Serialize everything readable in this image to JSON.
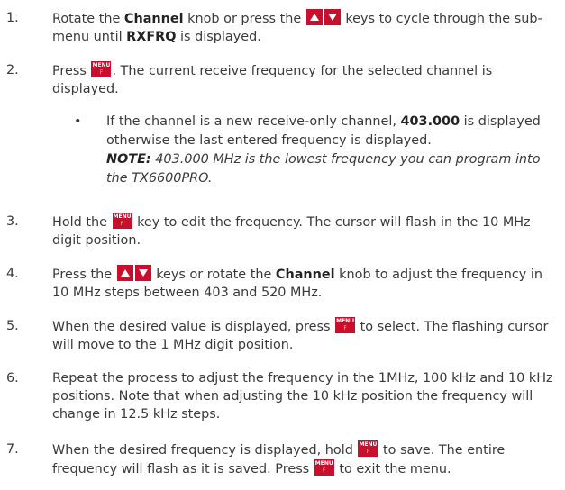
{
  "keys": {
    "menu_top": "MENU",
    "menu_bottom": "F",
    "up_arrow": "up-arrow-key",
    "down_arrow": "down-arrow-key",
    "key_color": "#c8102e"
  },
  "steps": [
    {
      "num": "1.",
      "t1": "Rotate the ",
      "b1": "Channel",
      "t2": " knob or press the ",
      "t3": " keys to cycle through the sub-menu until ",
      "b2": "RXFRQ",
      "t4": " is displayed."
    },
    {
      "num": "2.",
      "t1": "Press ",
      "t2": ". The current receive frequency for the selected channel is displayed."
    },
    {
      "bullet": "•",
      "t1": "If the channel is a new receive-only channel, ",
      "b1": "403.000",
      "t2": " is displayed otherwise the last entered frequency is displayed.",
      "note_label": "NOTE:",
      "note_text": " 403.000 MHz is the lowest frequency you can program into the TX6600PRO."
    },
    {
      "num": "3.",
      "t1": "Hold the ",
      "t2": " key to edit the frequency. The cursor will flash in the 10 MHz digit position."
    },
    {
      "num": "4.",
      "t1": "Press the ",
      "t2": " keys or rotate the ",
      "b1": "Channel",
      "t3": " knob to adjust the frequency in 10 MHz steps between 403 and 520 MHz."
    },
    {
      "num": "5.",
      "t1": "When the desired value is displayed, press ",
      "t2": " to select.  The flashing cursor will move to the 1 MHz digit position."
    },
    {
      "num": "6.",
      "t1": "Repeat the process to adjust the frequency in the 1MHz, 100 kHz and 10 kHz positions. Note that when adjusting the 10 kHz position the frequency will change in 12.5 kHz steps."
    },
    {
      "num": "7.",
      "t1": "When the desired frequency is displayed, hold ",
      "t2": " to save. The entire frequency will flash as it is saved. Press ",
      "t3": " to exit the menu."
    }
  ]
}
